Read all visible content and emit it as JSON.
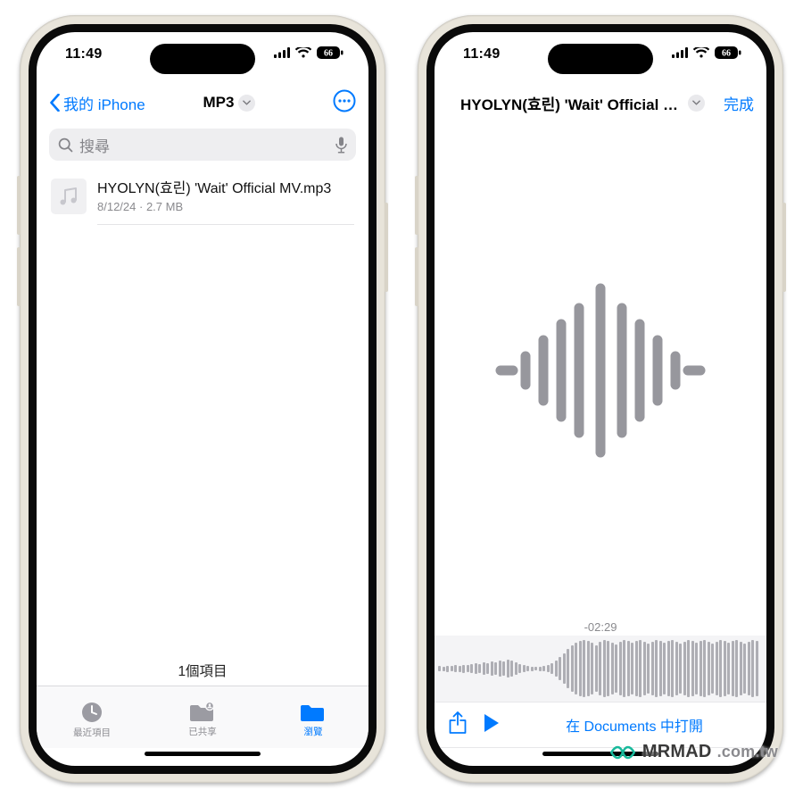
{
  "status": {
    "time": "11:49",
    "battery": "66"
  },
  "left": {
    "nav": {
      "back": "我的 iPhone",
      "title": "MP3"
    },
    "search": {
      "placeholder": "搜尋"
    },
    "file": {
      "name": "HYOLYN(효린) 'Wait' Official MV.mp3",
      "date": "8/12/24",
      "size": "2.7 MB"
    },
    "footer_count": "1個項目",
    "tabs": {
      "recents": "最近項目",
      "shared": "已共享",
      "browse": "瀏覽"
    }
  },
  "right": {
    "nav": {
      "title": "HYOLYN(효린) 'Wait' Official MV",
      "done": "完成"
    },
    "remaining": "-02:29",
    "open_in": "在 Documents 中打開"
  },
  "watermark": {
    "brand": "MRMAD",
    "suffix": ".com.tw"
  }
}
